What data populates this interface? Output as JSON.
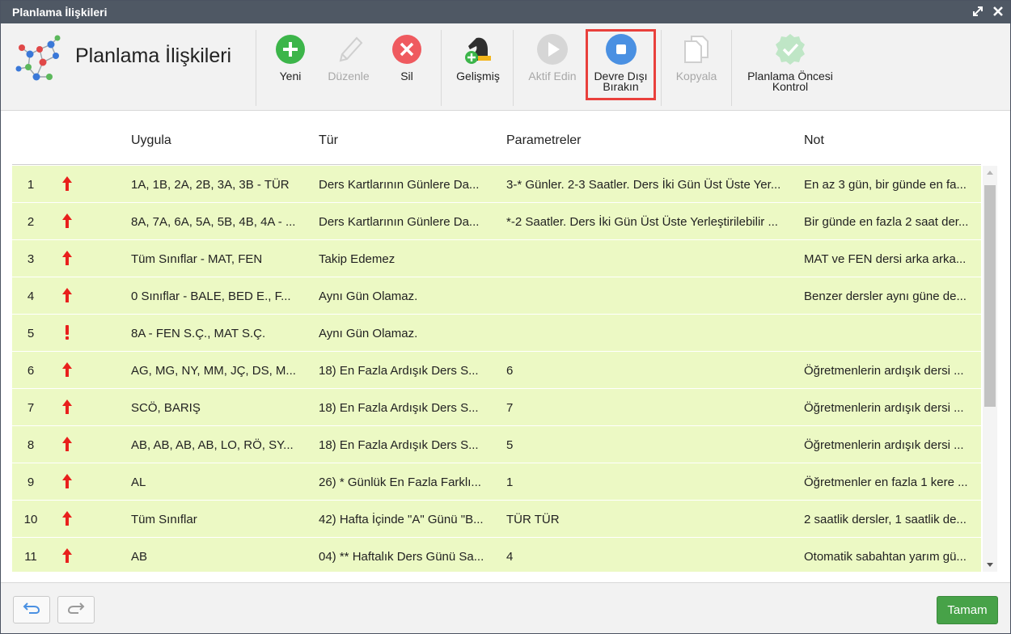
{
  "window": {
    "title": "Planlama İlişkileri"
  },
  "app": {
    "title": "Planlama İlişkileri"
  },
  "toolbar": {
    "new_label": "Yeni",
    "edit_label": "Düzenle",
    "delete_label": "Sil",
    "advanced_label": "Gelişmiş",
    "enable_label": "Aktif Edin",
    "disable_label_line1": "Devre Dışı",
    "disable_label_line2": "Bırakın",
    "copy_label": "Kopyala",
    "precheck_label_line1": "Planlama Öncesi",
    "precheck_label_line2": "Kontrol"
  },
  "table": {
    "columns": [
      "Uygula",
      "Tür",
      "Parametreler",
      "Not"
    ],
    "rows": [
      {
        "num": "1",
        "mark": "up-arrow",
        "apply": "1A, 1B, 2A, 2B, 3A, 3B - TÜR",
        "type": "Ders Kartlarının Günlere Da...",
        "params": "3-* Günler. 2-3 Saatler. Ders İki Gün Üst Üste Yer...",
        "note": "En az 3 gün, bir günde en fa..."
      },
      {
        "num": "2",
        "mark": "up-arrow",
        "apply": "8A, 7A, 6A, 5A, 5B, 4B, 4A - ...",
        "type": "Ders Kartlarının Günlere Da...",
        "params": "*-2 Saatler. Ders İki Gün Üst Üste Yerleştirilebilir ...",
        "note": "Bir günde en fazla 2 saat der..."
      },
      {
        "num": "3",
        "mark": "up-arrow",
        "apply": "Tüm Sınıflar - MAT, FEN",
        "type": "Takip Edemez",
        "params": "",
        "note": "MAT ve FEN dersi arka arka..."
      },
      {
        "num": "4",
        "mark": "up-arrow",
        "apply": "0 Sınıflar - BALE, BED E., F...",
        "type": "Aynı Gün Olamaz.",
        "params": "",
        "note": "Benzer dersler aynı güne de..."
      },
      {
        "num": "5",
        "mark": "exclamation",
        "apply": "8A - FEN S.Ç., MAT S.Ç.",
        "type": "Aynı Gün Olamaz.",
        "params": "",
        "note": ""
      },
      {
        "num": "6",
        "mark": "up-arrow",
        "apply": "AG, MG, NY, MM, JÇ, DS, M...",
        "type": "18) En Fazla Ardışık Ders S...",
        "params": "6",
        "note": "Öğretmenlerin ardışık dersi ..."
      },
      {
        "num": "7",
        "mark": "up-arrow",
        "apply": "SCÖ, BARIŞ",
        "type": "18) En Fazla Ardışık Ders S...",
        "params": "7",
        "note": "Öğretmenlerin ardışık dersi ..."
      },
      {
        "num": "8",
        "mark": "up-arrow",
        "apply": "AB, AB, AB, AB, LO, RÖ, SY...",
        "type": "18) En Fazla Ardışık Ders S...",
        "params": "5",
        "note": "Öğretmenlerin ardışık dersi ..."
      },
      {
        "num": "9",
        "mark": "up-arrow",
        "apply": "AL",
        "type": "26) * Günlük En Fazla Farklı...",
        "params": "1",
        "note": "Öğretmenler en fazla 1 kere ..."
      },
      {
        "num": "10",
        "mark": "up-arrow",
        "apply": "Tüm Sınıflar",
        "type": "42) Hafta İçinde \"A\" Günü \"B...",
        "params": "TÜR TÜR",
        "note": "2 saatlik dersler, 1 saatlik de..."
      },
      {
        "num": "11",
        "mark": "up-arrow",
        "apply": "AB",
        "type": "04) ** Haftalık Ders Günü Sa...",
        "params": "4",
        "note": "Otomatik sabahtan yarım gü..."
      }
    ]
  },
  "footer": {
    "ok_label": "Tamam"
  },
  "colors": {
    "row_bg": "#ecf9c4",
    "titlebar": "#4f5864",
    "mark_red": "#e8201c",
    "ok_green": "#47a248",
    "highlight": "#e9403c"
  }
}
